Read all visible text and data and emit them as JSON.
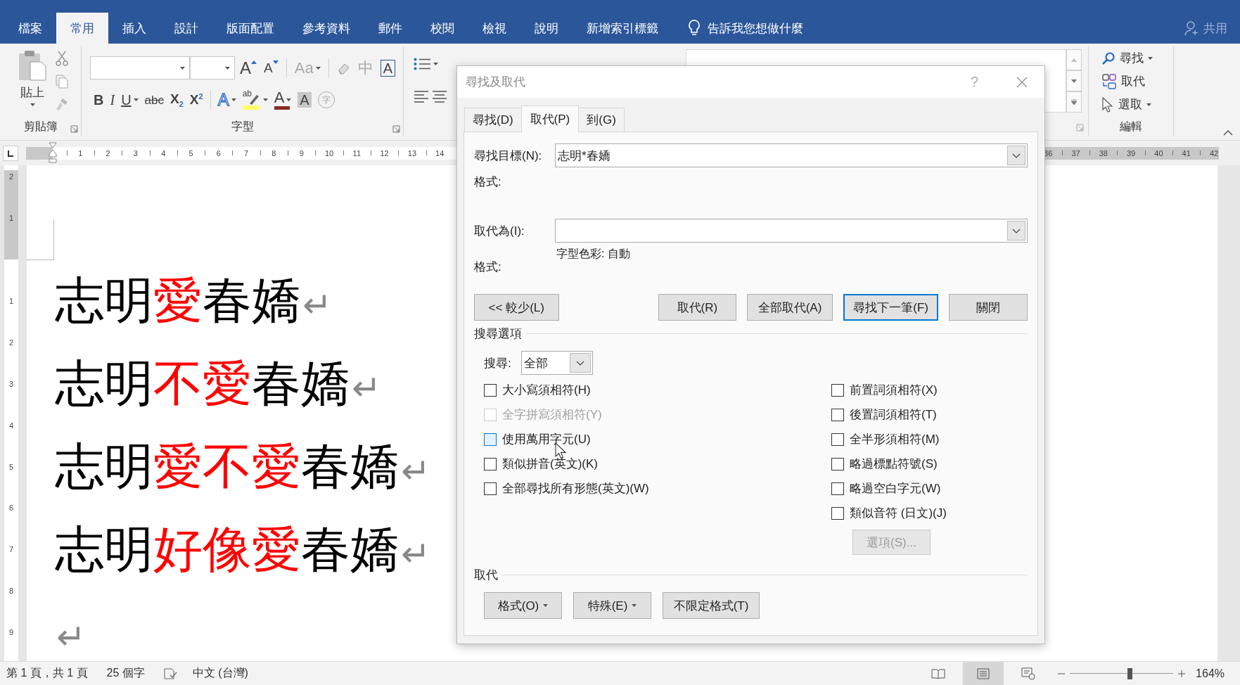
{
  "menu_tabs": [
    {
      "label": "檔案",
      "selected": false
    },
    {
      "label": "常用",
      "selected": true
    },
    {
      "label": "插入",
      "selected": false
    },
    {
      "label": "設計",
      "selected": false
    },
    {
      "label": "版面配置",
      "selected": false
    },
    {
      "label": "參考資料",
      "selected": false
    },
    {
      "label": "郵件",
      "selected": false
    },
    {
      "label": "校閱",
      "selected": false
    },
    {
      "label": "檢視",
      "selected": false
    },
    {
      "label": "說明",
      "selected": false
    },
    {
      "label": "新增索引標籤",
      "selected": false
    }
  ],
  "tell_me": "告訴我您想做什麼",
  "share": "共用",
  "ribbon": {
    "clipboard": {
      "paste": "貼上",
      "group": "剪貼簿"
    },
    "font": {
      "group": "字型",
      "row1": [
        {
          "kind": "grow",
          "glyph": "A"
        },
        {
          "kind": "shrink",
          "glyph": "A"
        },
        {
          "kind": "case",
          "glyph": "Aa",
          "menu": true
        },
        {
          "kind": "clear"
        },
        {
          "kind": "phonetic",
          "glyph": "中"
        },
        {
          "kind": "border",
          "glyph": "A"
        }
      ],
      "row2": [
        {
          "kind": "bold",
          "glyph": "B"
        },
        {
          "kind": "italic",
          "glyph": "I"
        },
        {
          "kind": "underline",
          "glyph": "U",
          "menu": true
        },
        {
          "kind": "strike",
          "glyph": "abc"
        },
        {
          "kind": "sub",
          "glyph": "X$_{2}$"
        },
        {
          "kind": "super",
          "glyph": "X$^{2}$"
        },
        {
          "kind": "effects",
          "glyph": "A",
          "menu": true
        },
        {
          "kind": "highlight",
          "glyph": "ab",
          "menu": true
        },
        {
          "kind": "color",
          "glyph": "A",
          "menu": true
        },
        {
          "kind": "shading",
          "glyph": "A"
        },
        {
          "kind": "enclose",
          "glyph": "字"
        }
      ]
    },
    "editing": {
      "find": "尋找",
      "replace": "取代",
      "select": "選取",
      "group": "編輯"
    }
  },
  "ruler": {
    "left_ticks": [
      "1",
      "2",
      "3",
      "4",
      "5",
      "6",
      "7",
      "8",
      "9",
      "10",
      "11",
      "12",
      "13",
      "14"
    ],
    "right_ticks": [
      "36",
      "37",
      "38",
      "39",
      "40",
      "41",
      "42"
    ]
  },
  "vertical_ruler": {
    "top_ticks": [
      "2",
      "1"
    ],
    "bottom_ticks": [
      "1",
      "2",
      "3",
      "4",
      "5",
      "6",
      "7",
      "8",
      "9"
    ]
  },
  "document": {
    "lines": [
      {
        "segments": [
          {
            "text": "志明",
            "color": "#000000"
          },
          {
            "text": "愛",
            "color": "#ff0000"
          },
          {
            "text": "春嬌",
            "color": "#000000"
          }
        ],
        "mark": "↵"
      },
      {
        "segments": [
          {
            "text": "志明",
            "color": "#000000"
          },
          {
            "text": "不愛",
            "color": "#ff0000"
          },
          {
            "text": "春嬌",
            "color": "#000000"
          }
        ],
        "mark": "↵"
      },
      {
        "segments": [
          {
            "text": "志明",
            "color": "#000000"
          },
          {
            "text": "愛不愛",
            "color": "#ff0000"
          },
          {
            "text": "春嬌",
            "color": "#000000"
          }
        ],
        "mark": "↵"
      },
      {
        "segments": [
          {
            "text": "志明",
            "color": "#000000"
          },
          {
            "text": "好像愛",
            "color": "#ff0000"
          },
          {
            "text": "春嬌",
            "color": "#000000"
          }
        ],
        "mark": "↵"
      },
      {
        "mark": "↵"
      }
    ]
  },
  "dialog": {
    "title": "尋找及取代",
    "help": "?",
    "tabs": [
      {
        "label": "尋找(D)",
        "selected": false
      },
      {
        "label": "取代(P)",
        "selected": true
      },
      {
        "label": "到(G)",
        "selected": false
      }
    ],
    "find_label": "尋找目標(N):",
    "find_value": "志明*春嬌",
    "find_format_label": "格式:",
    "replace_label": "取代為(I):",
    "replace_format_label": "格式:",
    "replace_format_value": "字型色彩: 自動",
    "buttons": [
      {
        "label": "<< 較少(L)",
        "default": false
      },
      {
        "label": "取代(R)",
        "default": false
      },
      {
        "label": "全部取代(A)",
        "default": false
      },
      {
        "label": "尋找下一筆(F)",
        "default": true
      },
      {
        "label": "關閉",
        "default": false
      }
    ],
    "search_options_heading": "搜尋選項",
    "search_label": "搜尋:",
    "search_value": "全部",
    "options_left": [
      {
        "label": "大小寫須相符(H)",
        "checked": false,
        "disabled": false,
        "hovered": false
      },
      {
        "label": "全字拼寫須相符(Y)",
        "checked": false,
        "disabled": true,
        "hovered": false
      },
      {
        "label": "使用萬用字元(U)",
        "checked": false,
        "disabled": false,
        "hovered": true
      },
      {
        "label": "類似拼音(英文)(K)",
        "checked": false,
        "disabled": false,
        "hovered": false
      },
      {
        "label": "全部尋找所有形態(英文)(W)",
        "checked": false,
        "disabled": false,
        "hovered": false
      }
    ],
    "options_right": [
      {
        "label": "前置詞須相符(X)",
        "checked": false,
        "disabled": false,
        "hovered": false
      },
      {
        "label": "後置詞須相符(T)",
        "checked": false,
        "disabled": false,
        "hovered": false
      },
      {
        "label": "全半形須相符(M)",
        "checked": false,
        "disabled": false,
        "hovered": false
      },
      {
        "label": "略過標點符號(S)",
        "checked": false,
        "disabled": false,
        "hovered": false
      },
      {
        "label": "略過空白字元(W)",
        "checked": false,
        "disabled": false,
        "hovered": false
      },
      {
        "label": "類似音符 (日文)(J)",
        "checked": false,
        "disabled": false,
        "hovered": false
      }
    ],
    "more_button": {
      "label": "選項(S)...",
      "disabled": true
    },
    "replace_heading": "取代",
    "format_buttons": [
      {
        "label": "格式(O)",
        "menu": true
      },
      {
        "label": "特殊(E)",
        "menu": true
      },
      {
        "label": "不限定格式(T)",
        "menu": false
      }
    ]
  },
  "status_bar": {
    "page": "第 1 頁，共 1 頁",
    "words": "25 個字",
    "language": "中文 (台灣)",
    "views": [
      {
        "kind": "read",
        "selected": false
      },
      {
        "kind": "print",
        "selected": true
      },
      {
        "kind": "web",
        "selected": false
      }
    ],
    "zoom": {
      "level": 0.58,
      "reading": "164%"
    }
  }
}
